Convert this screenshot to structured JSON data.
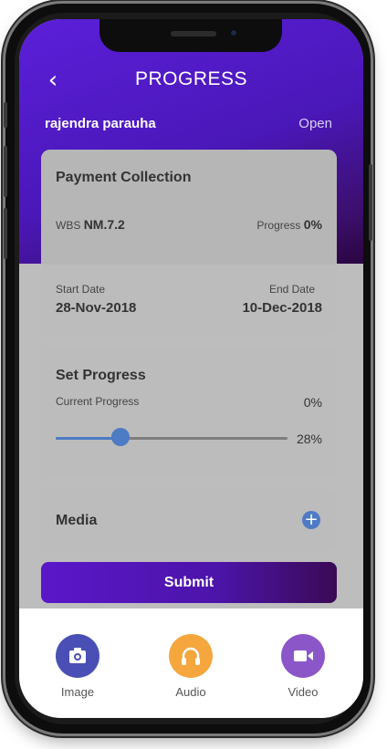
{
  "header": {
    "title": "PROGRESS",
    "back_icon": "chevron-left-icon"
  },
  "task": {
    "user": "rajendra parauha",
    "status": "Open"
  },
  "payment_card": {
    "title": "Payment Collection",
    "wbs_label": "WBS",
    "wbs_value": "NM.7.2",
    "progress_label": "Progress",
    "progress_value": "0%",
    "start_label": "Start Date",
    "start_value": "28-Nov-2018",
    "end_label": "End Date",
    "end_value": "10-Dec-2018"
  },
  "set_progress": {
    "title": "Set Progress",
    "current_label": "Current Progress",
    "current_value": "0%",
    "slider_value": "28%",
    "slider_level": 28
  },
  "media": {
    "title": "Media",
    "add_icon": "plus-circle-icon"
  },
  "submit_label": "Submit",
  "bottom_bar": [
    {
      "label": "Image",
      "icon": "camera-icon",
      "color": "#4a4fb5"
    },
    {
      "label": "Audio",
      "icon": "headphones-icon",
      "color": "#f5a63d"
    },
    {
      "label": "Video",
      "icon": "video-camera-icon",
      "color": "#8b56c8"
    }
  ],
  "colors": {
    "accent": "#5b1fd9",
    "slider": "#4d7bc4"
  }
}
